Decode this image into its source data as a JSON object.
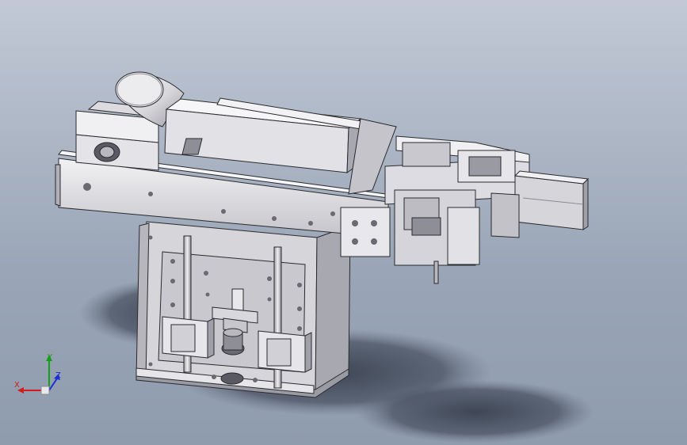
{
  "viewport": {
    "model": "cad-assembly",
    "colors": {
      "steel_light": "#eeeef0",
      "steel_mid": "#d2d2d6",
      "steel_dark": "#8a8a92",
      "edge": "#2a2a2e",
      "shadow": "#3e4654"
    }
  },
  "triad": {
    "x_label": "X",
    "y_label": "Y",
    "z_label": "Z",
    "x_color": "#d41a1a",
    "y_color": "#14a014",
    "z_color": "#1a2fd4"
  }
}
